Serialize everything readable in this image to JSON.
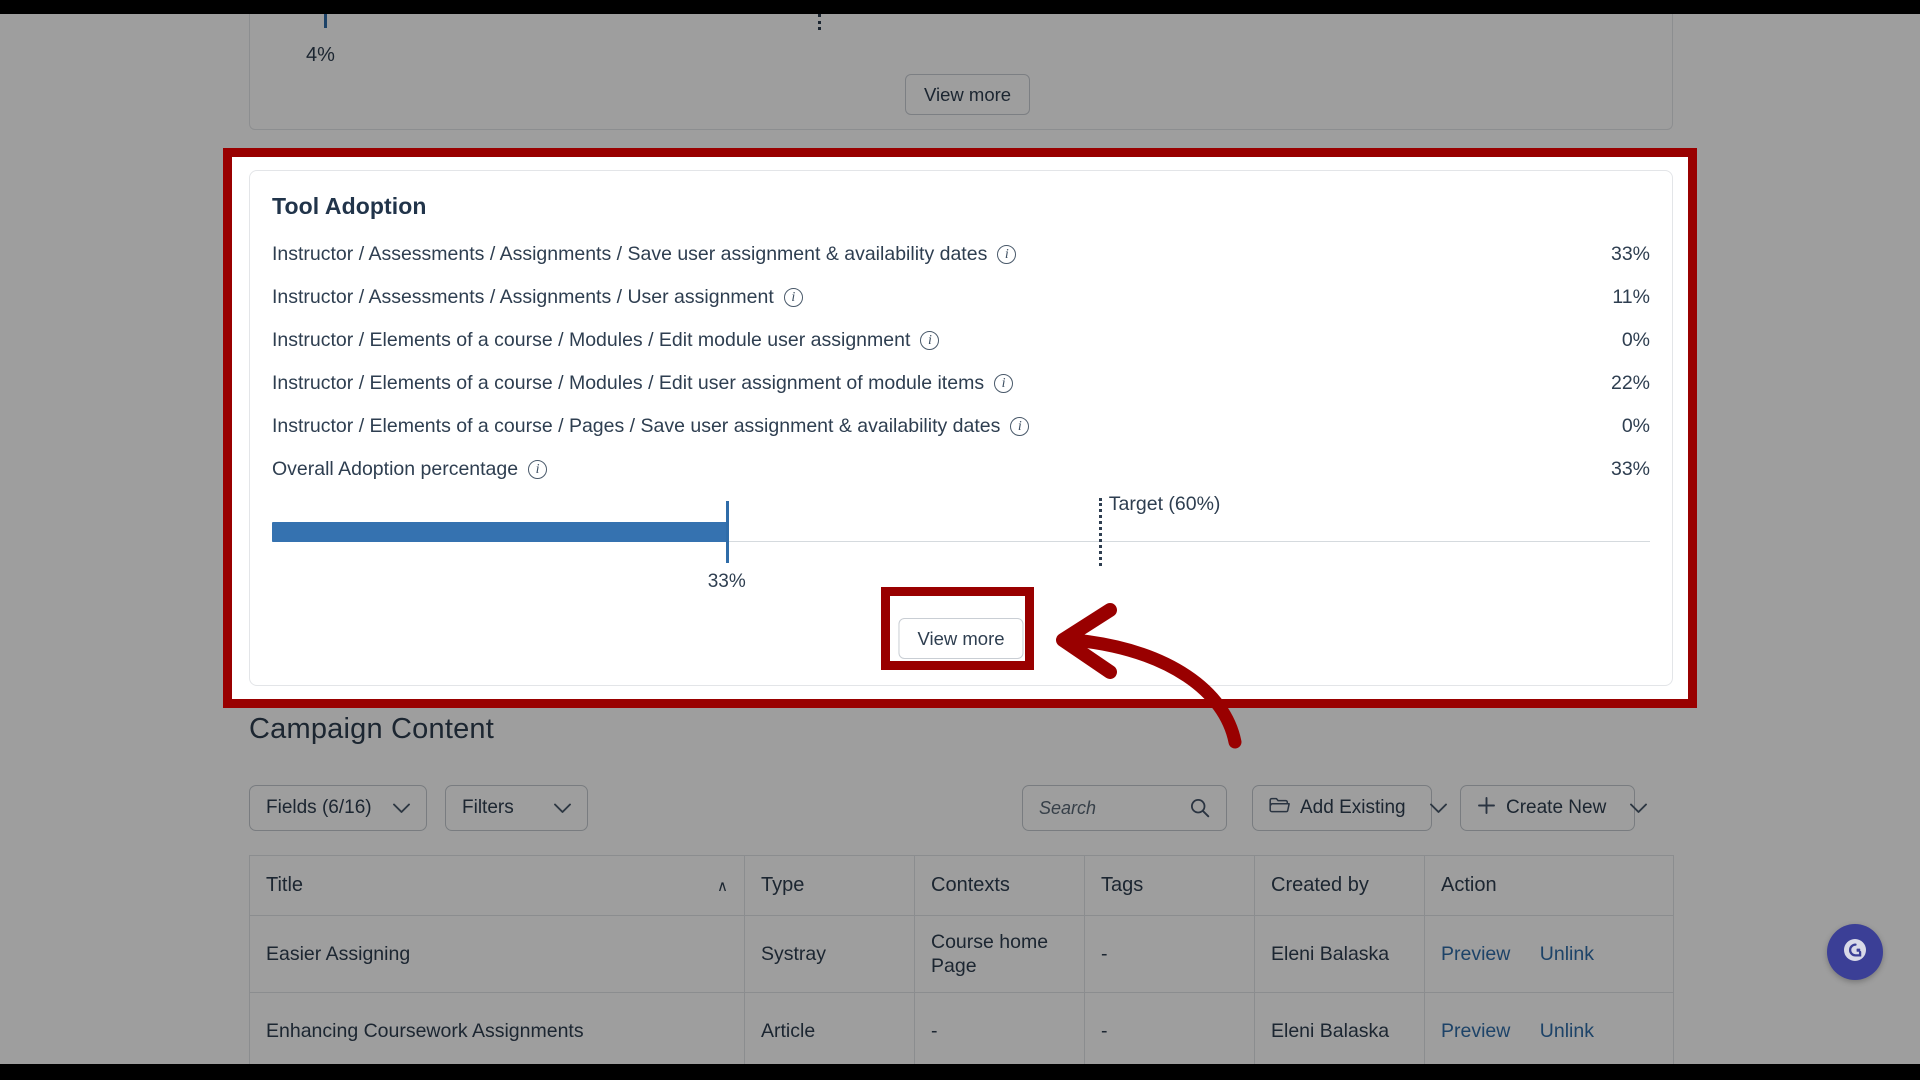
{
  "top_card": {
    "bar_label": "4%",
    "view_more_label": "View more"
  },
  "tool_adoption": {
    "title": "Tool Adoption",
    "rows": [
      {
        "label": "Instructor / Assessments / Assignments / Save user assignment & availability dates",
        "value": "33%"
      },
      {
        "label": "Instructor / Assessments / Assignments / User assignment",
        "value": "11%"
      },
      {
        "label": "Instructor / Elements of a course / Modules / Edit module user assignment",
        "value": "0%"
      },
      {
        "label": "Instructor / Elements of a course / Modules / Edit user assignment of module items",
        "value": "22%"
      },
      {
        "label": "Instructor / Elements of a course / Pages / Save user assignment & availability dates",
        "value": "0%"
      },
      {
        "label": "Overall Adoption percentage",
        "value": "33%"
      }
    ],
    "info_icon": "info-icon",
    "progress": {
      "value_label": "33%",
      "value_percent": 33,
      "target_label": "Target (60%)",
      "target_percent": 60,
      "bar_color": "#3572b0"
    },
    "view_more_label": "View more"
  },
  "campaign_content": {
    "title": "Campaign Content",
    "toolbar": {
      "fields_label": "Fields (6/16)",
      "filters_label": "Filters",
      "search_placeholder": "Search",
      "search_value": "",
      "add_existing_label": "Add Existing",
      "create_new_label": "Create New"
    },
    "table": {
      "columns": [
        "Title",
        "Type",
        "Contexts",
        "Tags",
        "Created by",
        "Action"
      ],
      "sort_column": "Title",
      "sort_caret": "∧",
      "rows": [
        {
          "title": "Easier Assigning",
          "type": "Systray",
          "contexts": "Course home Page",
          "tags": "-",
          "created_by": "Eleni Balaska",
          "preview": "Preview",
          "unlink": "Unlink"
        },
        {
          "title": "Enhancing Coursework Assignments",
          "type": "Article",
          "contexts": "-",
          "tags": "-",
          "created_by": "Eleni Balaska",
          "preview": "Preview",
          "unlink": "Unlink"
        }
      ]
    }
  },
  "annotations": {
    "highlight_color": "#990000"
  },
  "chat_widget": {
    "icon": "chat-bubble-icon",
    "color": "#3b3f96"
  }
}
